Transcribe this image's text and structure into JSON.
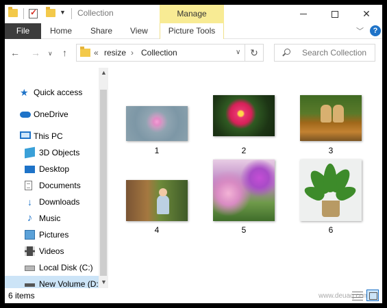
{
  "window": {
    "title": "Collection",
    "context_tab_group": "Manage",
    "controls": {
      "minimize": "–",
      "maximize": "□",
      "close": "✕"
    }
  },
  "ribbon": {
    "file": "File",
    "tabs": [
      "Home",
      "Share",
      "View"
    ],
    "context_tab": "Picture Tools",
    "help": "?"
  },
  "address_bar": {
    "overflow": "«",
    "segments": [
      "resize",
      "Collection"
    ],
    "separator": "›"
  },
  "search": {
    "placeholder": "Search Collection"
  },
  "nav_pane": {
    "items": [
      {
        "label": "Quick access",
        "icon": "star-icon"
      },
      {
        "label": "OneDrive",
        "icon": "cloud-icon"
      },
      {
        "label": "This PC",
        "icon": "computer-icon"
      },
      {
        "label": "3D Objects",
        "icon": "cube-icon"
      },
      {
        "label": "Desktop",
        "icon": "desktop-icon"
      },
      {
        "label": "Documents",
        "icon": "document-icon"
      },
      {
        "label": "Downloads",
        "icon": "download-icon"
      },
      {
        "label": "Music",
        "icon": "music-icon"
      },
      {
        "label": "Pictures",
        "icon": "pictures-icon"
      },
      {
        "label": "Videos",
        "icon": "video-icon"
      },
      {
        "label": "Local Disk (C:)",
        "icon": "disk-icon"
      },
      {
        "label": "New Volume (D:",
        "icon": "drive-icon",
        "selected": true
      }
    ]
  },
  "files": [
    {
      "name": "1",
      "depicts": "pink flower"
    },
    {
      "name": "2",
      "depicts": "red dahlia"
    },
    {
      "name": "3",
      "depicts": "puppies"
    },
    {
      "name": "4",
      "depicts": "child"
    },
    {
      "name": "5",
      "depicts": "flower field"
    },
    {
      "name": "6",
      "depicts": "potted plant"
    }
  ],
  "status": {
    "item_count": "6 items",
    "watermark": "www.deuaq.com"
  },
  "colors": {
    "accent": "#1e73c8",
    "manage_tab": "#f8eb94",
    "file_tab": "#3c3c3c",
    "selection": "#cce4f7"
  }
}
